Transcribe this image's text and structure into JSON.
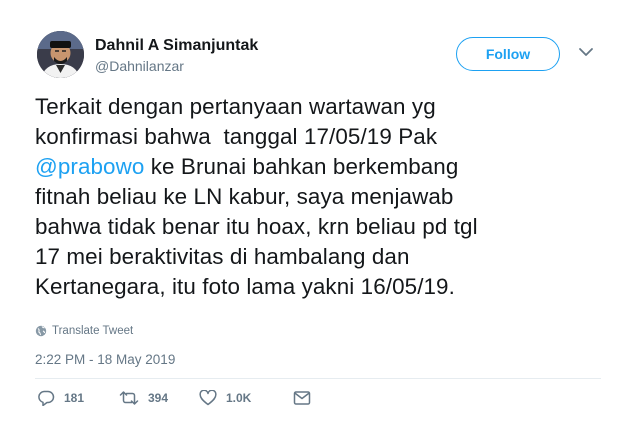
{
  "author": {
    "name": "Dahnil A Simanjuntak",
    "handle": "@Dahnilanzar"
  },
  "follow_button": {
    "label": "Follow"
  },
  "tweet": {
    "lines": [
      [
        "Terkait dengan pertanyaan wartawan yg"
      ],
      [
        "konfirmasi bahwa  tanggal 17/05/19 Pak"
      ],
      [
        "@prabowo",
        " ke Brunai bahkan berkembang"
      ],
      [
        "fitnah beliau ke LN kabur, saya menjawab"
      ],
      [
        "bahwa tidak benar itu hoax, krn beliau pd tgl"
      ],
      [
        "17 mei beraktivitas di hambalang dan"
      ],
      [
        "Kertanegara, itu foto lama yakni 16/05/19."
      ]
    ],
    "translate_label": "Translate Tweet",
    "timestamp": "2:22 PM - 18 May 2019"
  },
  "actions": {
    "reply_count": "181",
    "retweet_count": "394",
    "like_count": "1.0K"
  },
  "icons": {
    "globe": "globe-icon",
    "reply": "reply-icon",
    "retweet": "retweet-icon",
    "like": "heart-icon",
    "dm": "envelope-icon",
    "caret": "chevron-down-icon"
  },
  "colors": {
    "accent": "#1da1f2",
    "text": "#14171a",
    "secondary": "#657786"
  }
}
